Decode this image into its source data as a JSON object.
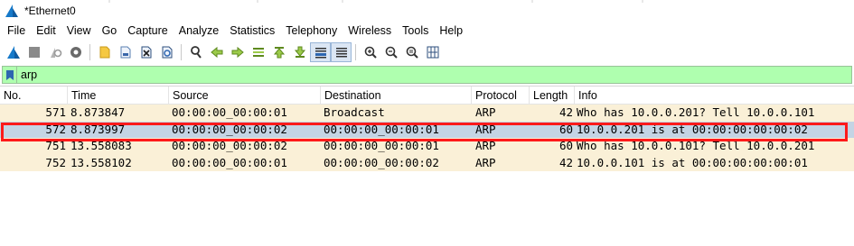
{
  "window": {
    "title": "*Ethernet0"
  },
  "menu": [
    "File",
    "Edit",
    "View",
    "Go",
    "Capture",
    "Analyze",
    "Statistics",
    "Telephony",
    "Wireless",
    "Tools",
    "Help"
  ],
  "toolbar": {
    "icons": [
      "shark-fin-start-icon",
      "stop-icon",
      "restart-icon",
      "capture-options-icon",
      "open-file-icon",
      "save-file-icon",
      "close-file-icon",
      "reload-icon",
      "find-packet-icon",
      "go-back-icon",
      "go-forward-icon",
      "go-to-packet-icon",
      "first-packet-icon",
      "last-packet-icon",
      "auto-scroll-icon",
      "colorize-icon",
      "zoom-in-icon",
      "zoom-out-icon",
      "normal-size-icon",
      "resize-columns-icon"
    ]
  },
  "filter": {
    "value": "arp"
  },
  "columns": [
    "No.",
    "Time",
    "Source",
    "Destination",
    "Protocol",
    "Length",
    "Info"
  ],
  "packets": [
    {
      "no": "571",
      "time": "8.873847",
      "source": "00:00:00_00:00:01",
      "destination": "Broadcast",
      "protocol": "ARP",
      "length": "42",
      "info": "Who has 10.0.0.201? Tell 10.0.0.101"
    },
    {
      "no": "572",
      "time": "8.873997",
      "source": "00:00:00_00:00:02",
      "destination": "00:00:00_00:00:01",
      "protocol": "ARP",
      "length": "60",
      "info": "10.0.0.201 is at 00:00:00:00:00:02"
    },
    {
      "no": "751",
      "time": "13.558083",
      "source": "00:00:00_00:00:02",
      "destination": "00:00:00_00:00:01",
      "protocol": "ARP",
      "length": "60",
      "info": "Who has 10.0.0.101? Tell 10.0.0.201"
    },
    {
      "no": "752",
      "time": "13.558102",
      "source": "00:00:00_00:00:01",
      "destination": "00:00:00_00:00:02",
      "protocol": "ARP",
      "length": "42",
      "info": "10.0.0.101 is at 00:00:00:00:00:01"
    }
  ],
  "selected_row": 1,
  "colors": {
    "arp_row": "#faf0d7",
    "selected_row": "#c4d4e4",
    "filter_valid": "#afffaf",
    "highlight": "#ff1a1a"
  }
}
